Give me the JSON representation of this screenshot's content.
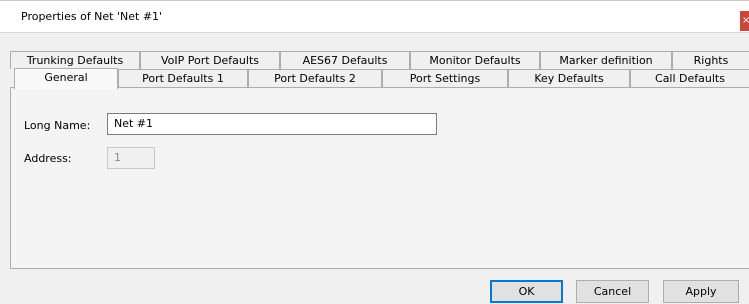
{
  "window": {
    "title": "Properties of Net 'Net #1'",
    "close_glyph": "×"
  },
  "tabs": {
    "row1": [
      {
        "label": "Trunking Defaults"
      },
      {
        "label": "VoIP Port Defaults"
      },
      {
        "label": "AES67 Defaults"
      },
      {
        "label": "Monitor Defaults"
      },
      {
        "label": "Marker definition"
      },
      {
        "label": "Rights"
      }
    ],
    "row2": [
      {
        "label": "General",
        "selected": true
      },
      {
        "label": "Port Defaults 1"
      },
      {
        "label": "Port Defaults 2"
      },
      {
        "label": "Port Settings"
      },
      {
        "label": "Key Defaults"
      },
      {
        "label": "Call Defaults"
      }
    ]
  },
  "general": {
    "long_name_label": "Long Name:",
    "long_name_value": "Net #1",
    "address_label": "Address:",
    "address_value": "1"
  },
  "buttons": {
    "ok": "OK",
    "cancel": "Cancel",
    "apply": "Apply"
  },
  "colors": {
    "close_button": "#c9463d",
    "default_button_border": "#0078d7"
  }
}
